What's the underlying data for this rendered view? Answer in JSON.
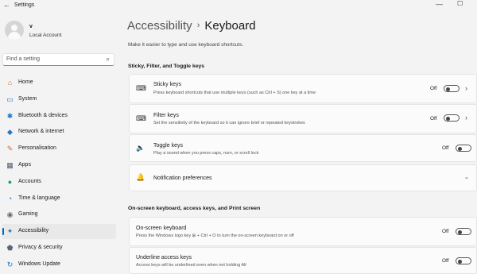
{
  "window": {
    "title": "Settings",
    "back_glyph": "←",
    "minimize_glyph": "—",
    "maximize_glyph": "☐"
  },
  "user": {
    "name": "v",
    "account_type": "Local Account"
  },
  "search": {
    "placeholder": "Find a setting"
  },
  "nav": [
    {
      "label": "Home",
      "icon": "home-icon",
      "color": "#d8692a"
    },
    {
      "label": "System",
      "icon": "system-icon",
      "color": "#1f76c9"
    },
    {
      "label": "Bluetooth & devices",
      "icon": "bluetooth-icon",
      "color": "#1f76c9"
    },
    {
      "label": "Network & internet",
      "icon": "network-icon",
      "color": "#1f76c9"
    },
    {
      "label": "Personalisation",
      "icon": "brush-icon",
      "color": "#d8692a"
    },
    {
      "label": "Apps",
      "icon": "apps-icon",
      "color": "#4f5b6b"
    },
    {
      "label": "Accounts",
      "icon": "accounts-icon",
      "color": "#1fa35b"
    },
    {
      "label": "Time & language",
      "icon": "globe-clock-icon",
      "color": "#1f76c9"
    },
    {
      "label": "Gaming",
      "icon": "gamepad-icon",
      "color": "#666666"
    },
    {
      "label": "Accessibility",
      "icon": "accessibility-icon",
      "color": "#1f76c9",
      "selected": true
    },
    {
      "label": "Privacy & security",
      "icon": "shield-icon",
      "color": "#5a6675"
    },
    {
      "label": "Windows Update",
      "icon": "update-icon",
      "color": "#1f76c9"
    }
  ],
  "breadcrumb": {
    "parent": "Accessibility",
    "separator": "›",
    "current": "Keyboard"
  },
  "description": "Make it easier to type and use keyboard shortcuts.",
  "sections": {
    "sticky": "Sticky, Filter, and Toggle keys",
    "onscreen": "On-screen keyboard, access keys, and Print screen"
  },
  "settings": {
    "sticky_keys": {
      "title": "Sticky keys",
      "desc": "Press keyboard shortcuts that use multiple keys (such as Ctrl + S) one key at a time",
      "state": "Off"
    },
    "filter_keys": {
      "title": "Filter keys",
      "desc": "Set the sensitivity of the keyboard so it can ignore brief or repeated keystrokes",
      "state": "Off"
    },
    "toggle_keys": {
      "title": "Toggle keys",
      "desc": "Play a sound when you press caps, num, or scroll lock",
      "state": "Off"
    },
    "notification_prefs": {
      "title": "Notification preferences"
    },
    "onscreen_keyboard": {
      "title": "On-screen keyboard",
      "desc": "Press the Windows logo key ⊞ + Ctrl + O to turn the on-screen keyboard on or off",
      "state": "Off"
    },
    "underline_access": {
      "title": "Underline access keys",
      "desc": "Access keys will be underlined even when not holding Alt",
      "state": "Off"
    }
  },
  "accent_color": "#0067c0"
}
